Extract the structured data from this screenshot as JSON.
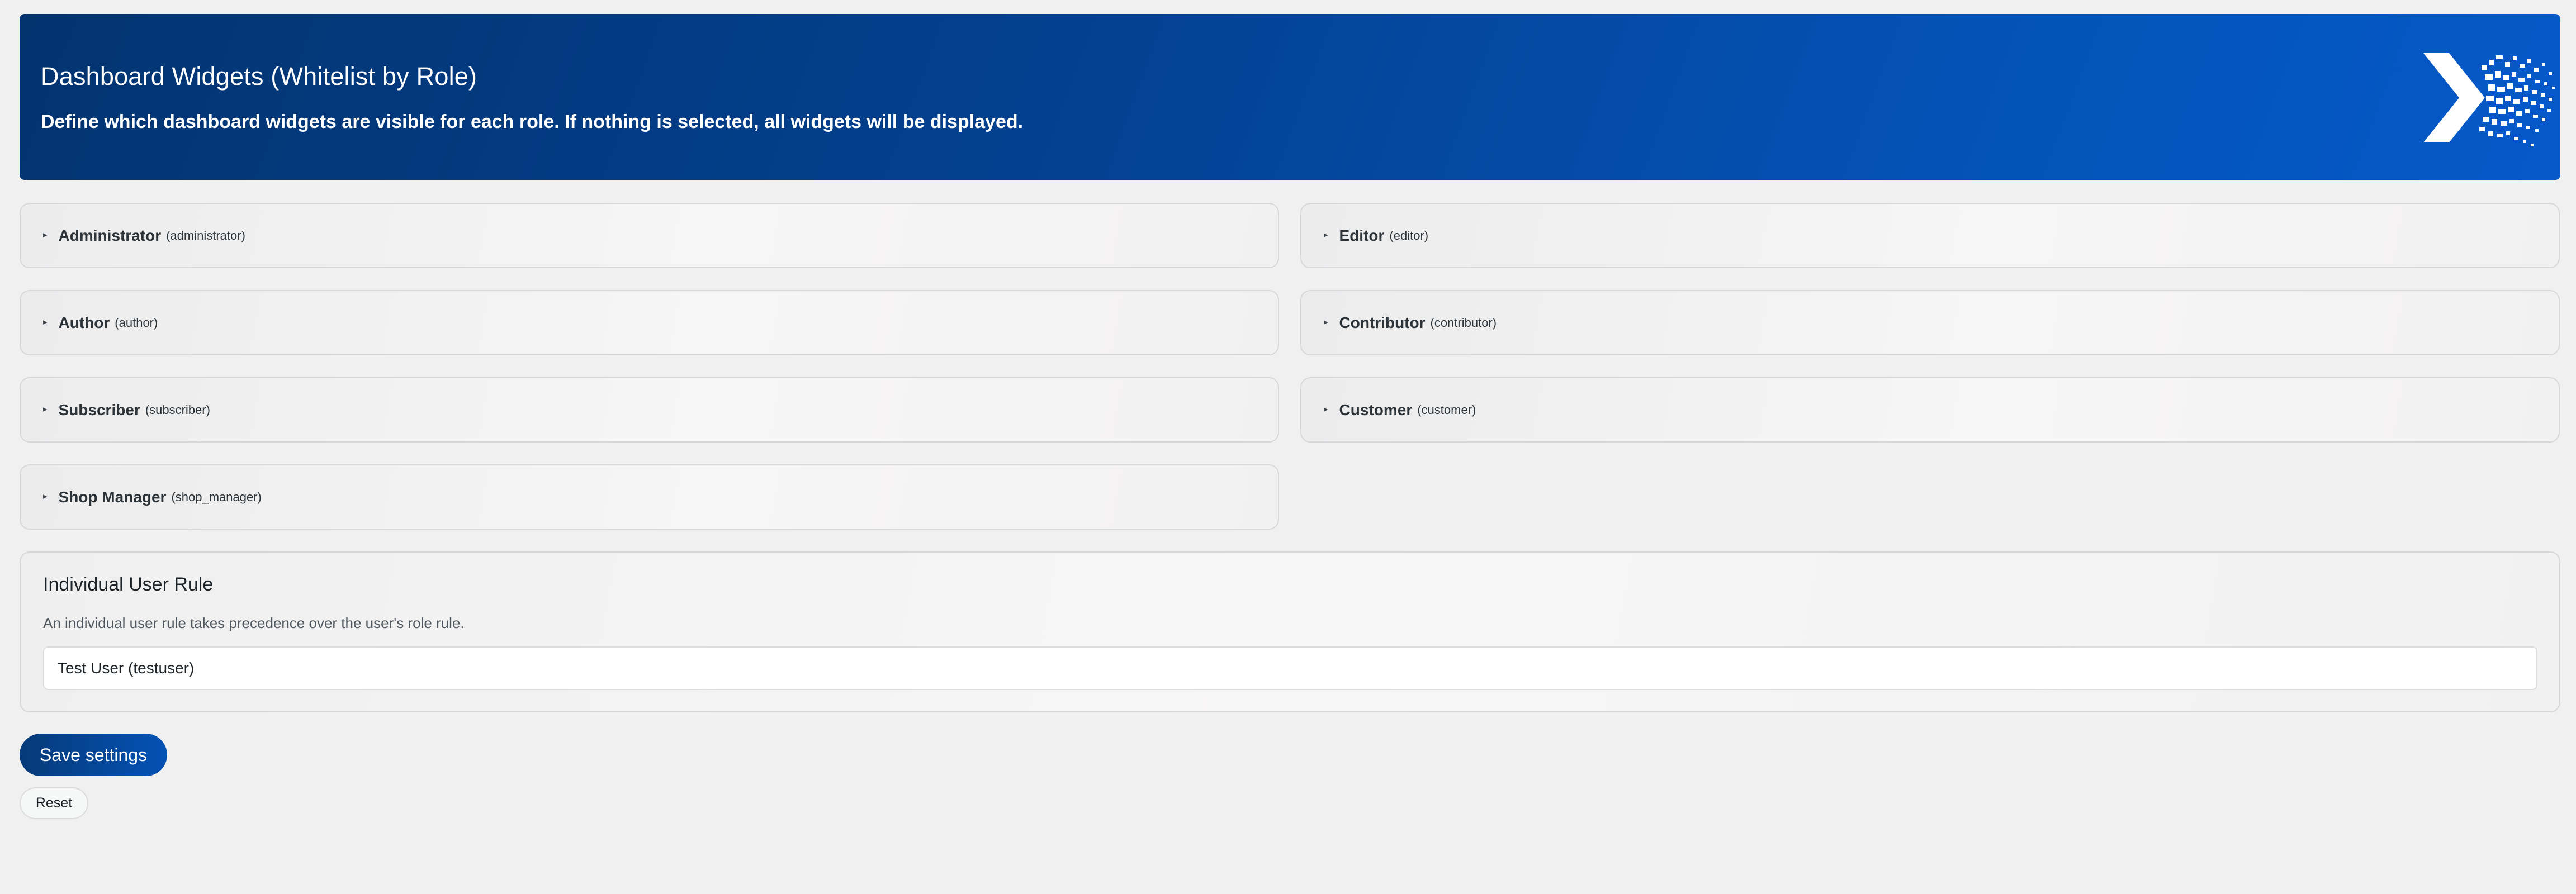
{
  "header": {
    "title": "Dashboard Widgets (Whitelist by Role)",
    "subtitle": "Define which dashboard widgets are visible for each role. If nothing is selected, all widgets will be displayed.",
    "logo_icon": "arrow-disintegrate-logo-icon"
  },
  "roles": [
    {
      "label": "Administrator",
      "slug": "(administrator)"
    },
    {
      "label": "Editor",
      "slug": "(editor)"
    },
    {
      "label": "Author",
      "slug": "(author)"
    },
    {
      "label": "Contributor",
      "slug": "(contributor)"
    },
    {
      "label": "Subscriber",
      "slug": "(subscriber)"
    },
    {
      "label": "Customer",
      "slug": "(customer)"
    },
    {
      "label": "Shop Manager",
      "slug": "(shop_manager)"
    }
  ],
  "user_rule": {
    "title": "Individual User Rule",
    "description": "An individual user rule takes precedence over the user's role rule.",
    "selected_user": "Test User (testuser)"
  },
  "actions": {
    "save_label": "Save settings",
    "reset_label": "Reset"
  },
  "colors": {
    "brand_dark": "#033470",
    "brand_light": "#0559c9",
    "page_bg": "#f0f0f1"
  }
}
